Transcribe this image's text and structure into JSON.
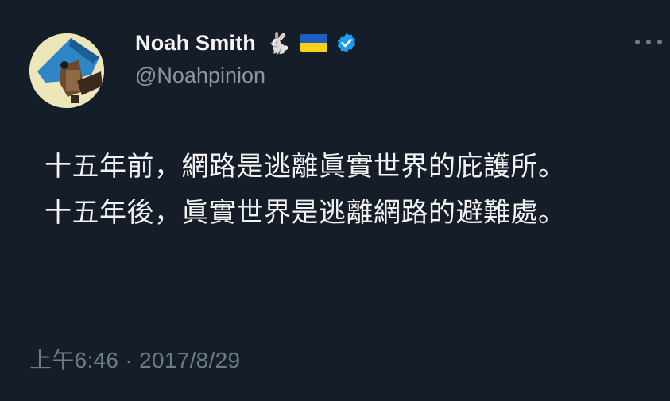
{
  "user": {
    "display_name": "Noah Smith",
    "handle": "@Noahpinion",
    "badges": [
      "rabbit-icon",
      "ukraine-flag-icon",
      "verified-icon"
    ],
    "rabbit_glyph": "🐇"
  },
  "tweet": {
    "lines": [
      "十五年前，網路是逃離眞實世界的庇護所。",
      "十五年後，眞實世界是逃離網路的避難處。"
    ],
    "timestamp": "上午6:46 · 2017/8/29"
  },
  "colors": {
    "background": "#151d29",
    "text": "#f2f2f2",
    "secondary_text": "#8a96a3",
    "verified": "#1d9bf0",
    "flag_blue": "#1f5fbf",
    "flag_yellow": "#f7d21b"
  }
}
